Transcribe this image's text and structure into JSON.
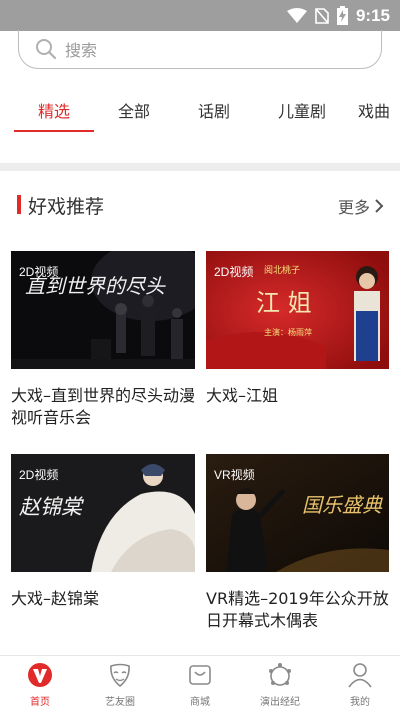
{
  "status_bar": {
    "time": "9:15",
    "icons": [
      "wifi-icon",
      "no-sim-icon",
      "battery-charging-icon"
    ]
  },
  "search": {
    "placeholder": "搜索",
    "icon": "search-icon"
  },
  "tabs": [
    {
      "label": "精选",
      "active": true
    },
    {
      "label": "全部",
      "active": false
    },
    {
      "label": "话剧",
      "active": false
    },
    {
      "label": "儿童剧",
      "active": false
    },
    {
      "label": "戏曲",
      "active": false
    }
  ],
  "section": {
    "title": "好戏推荐",
    "more_label": "更多"
  },
  "cards": [
    {
      "badge": "2D视频",
      "title": "大戏–直到世界的尽头动漫视听音乐会",
      "poster_text": "直到世界的尽头"
    },
    {
      "badge": "2D视频",
      "title": "大戏–江姐",
      "poster_text": "江 姐",
      "poster_sub": "主演：杨雨萍",
      "poster_top": "阅北桃子"
    },
    {
      "badge": "2D视频",
      "title": "大戏–赵锦棠",
      "poster_text": "赵锦棠"
    },
    {
      "badge": "VR视频",
      "title": "VR精选–2019年公众开放日开幕式木偶表",
      "poster_text": "国乐盛典"
    }
  ],
  "bottom_nav": [
    {
      "label": "首页",
      "icon": "home-v-logo-icon",
      "active": true
    },
    {
      "label": "艺友圈",
      "icon": "mask-icon",
      "active": false
    },
    {
      "label": "商城",
      "icon": "shop-bag-icon",
      "active": false
    },
    {
      "label": "演出经纪",
      "icon": "agency-icon",
      "active": false
    },
    {
      "label": "我的",
      "icon": "profile-icon",
      "active": false
    }
  ],
  "colors": {
    "accent": "#e12b2b",
    "status_bar": "#9e9e9e",
    "divider": "#ededed"
  }
}
